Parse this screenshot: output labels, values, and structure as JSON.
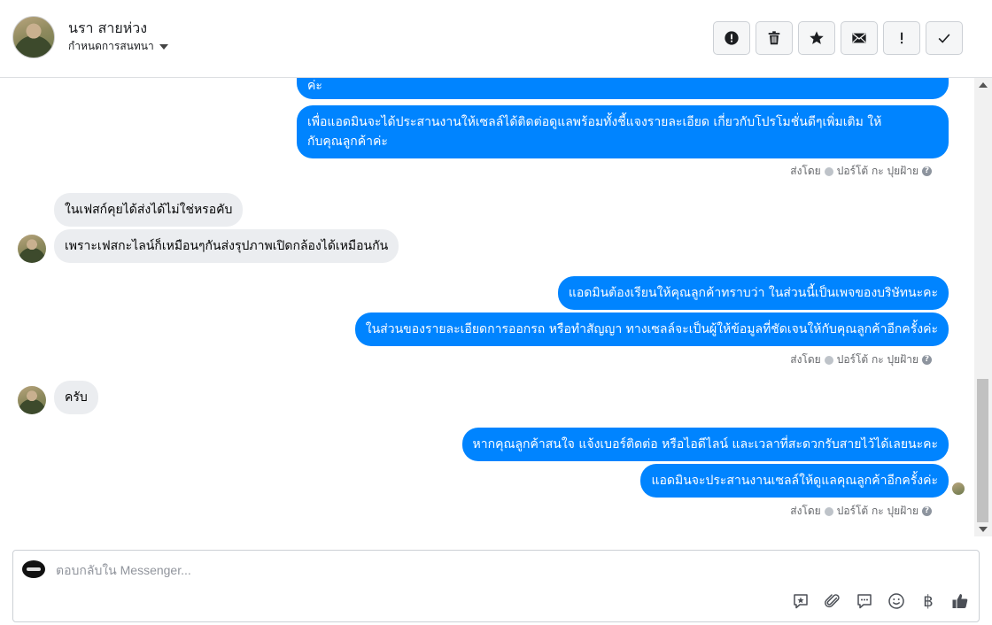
{
  "header": {
    "contact_name": "นรา สายห่วง",
    "conversation_settings": "กำหนดการสนทนา"
  },
  "toolbar": {
    "buttons": [
      {
        "name": "report-spam-icon"
      },
      {
        "name": "delete-icon"
      },
      {
        "name": "star-icon"
      },
      {
        "name": "mark-unread-icon"
      },
      {
        "name": "follow-up-icon"
      },
      {
        "name": "mark-done-icon"
      }
    ]
  },
  "messages": {
    "m1": "ค่ะ",
    "m2_line1": "เพื่อแอดมินจะได้ประสานงานให้เซลล์ได้ติดต่อดูแลพร้อมทั้งชี้แจงรายละเอียด เกี่ยวกับโปรโมชั่นดีๆเพิ่มเติม ให้",
    "m2_line2": "กับคุณลูกค้าค่ะ",
    "m3": "ในเฟสก์คุยได้ส่งได้ไม่ใช่หรอคับ",
    "m4": "เพราะเฟสกะไลน์ก็เหมือนๆกันส่งรุปภาพเปิดกล้องได้เหมือนกัน",
    "m5": "แอดมินต้องเรียนให้คุณลูกค้าทราบว่า ในส่วนนี้เป็นเพจของบริษัทนะคะ",
    "m6": "ในส่วนของรายละเอียดการออกรถ หรือทำสัญญา ทางเซลล์จะเป็นผู้ให้ข้อมูลที่ชัดเจนให้กับคุณลูกค้าอีกครั้งค่ะ",
    "m7": "ครับ",
    "m8": "หากคุณลูกค้าสนใจ แจ้งเบอร์ติดต่อ หรือไอดีไลน์ และเวลาที่สะดวกรับสายไว้ได้เลยนะคะ",
    "m9": "แอดมินจะประสานงานเซลล์ให้ดูแลคุณลูกค้าอีกครั้งค่ะ"
  },
  "sent_by": {
    "label": "ส่งโดย",
    "sender": "ปอร์โต้ กะ ปุยฝ้าย"
  },
  "composer": {
    "placeholder": "ตอบกลับใน Messenger...",
    "currency_symbol": "฿"
  },
  "colors": {
    "outgoing_bubble": "#0084ff",
    "incoming_bubble": "#ebedf0"
  }
}
